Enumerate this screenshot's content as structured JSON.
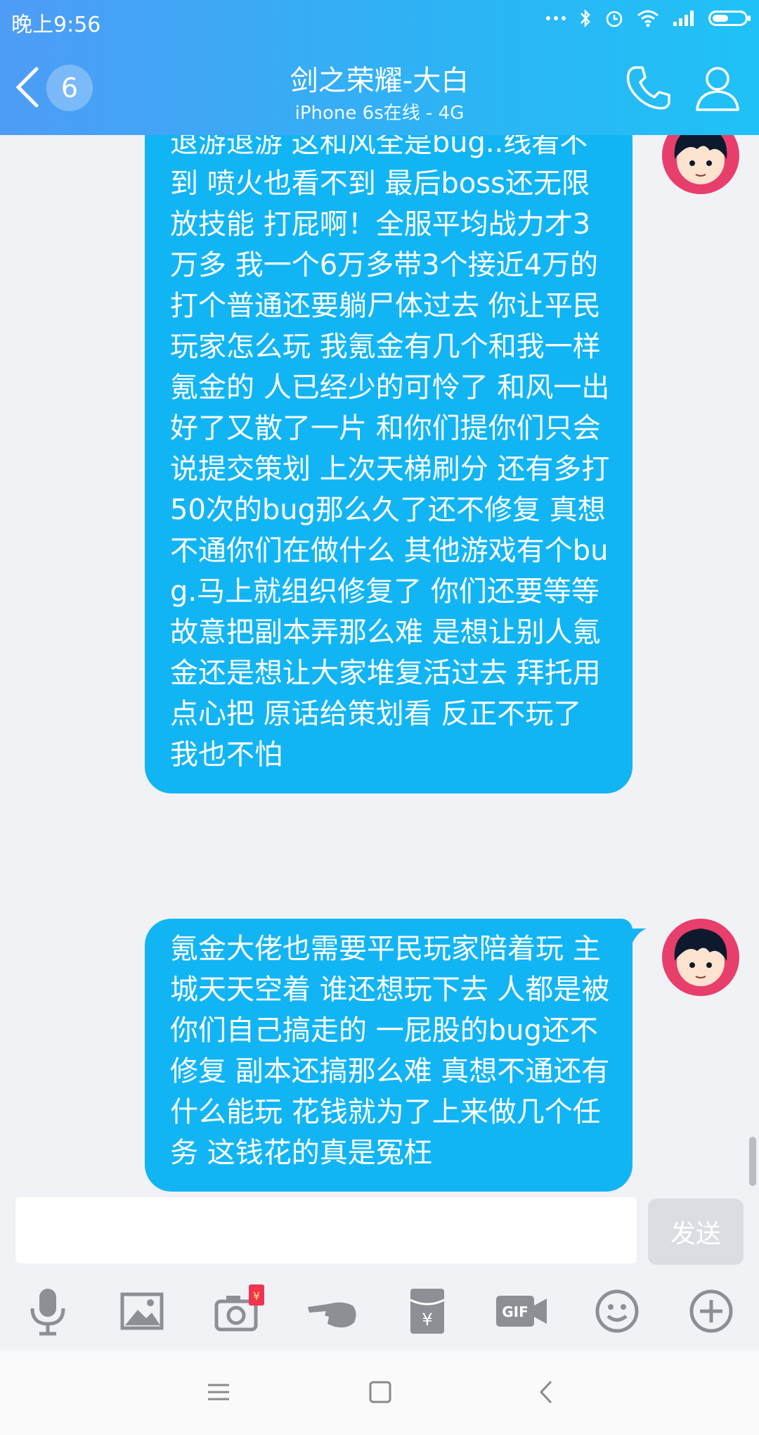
{
  "status_bar": {
    "time": "晚上9:56"
  },
  "header": {
    "unread_count": "6",
    "title": "剑之荣耀-大白",
    "subtitle": "iPhone 6s在线 - 4G"
  },
  "messages": [
    {
      "text": "退游退游  这和风全是bug..线看不到  喷火也看不到  最后boss还无限放技能  打屁啊！全服平均战力才3万多 我一个6万多带3个接近4万的打个普通还要躺尸体过去  你让平民玩家怎么玩  我氪金有几个和我一样氪金的  人已经少的可怜了  和风一出 好了又散了一片  和你们提你们只会说提交策划  上次天梯刷分 还有多打50次的bug那么久了还不修复  真想不通你们在做什么  其他游戏有个bug.马上就组织修复了  你们还要等等  故意把副本弄那么难  是想让别人氪金还是想让大家堆复活过去 拜托用点心把  原话给策划看  反正不玩了  我也不怕"
    },
    {
      "text": "氪金大佬也需要平民玩家陪着玩  主城天天空着  谁还想玩下去  人都是被你们自己搞走的  一屁股的bug还不修复  副本还搞那么难  真想不通还有什么能玩  花钱就为了上来做几个任务  这钱花的真是冤枉"
    }
  ],
  "input": {
    "value": "",
    "send_label": "发送"
  },
  "toolbar": {
    "items": [
      "microphone-icon",
      "image-icon",
      "camera-redpacket-icon",
      "poke-hand-icon",
      "red-envelope-icon",
      "gif-icon",
      "emoji-icon",
      "plus-icon"
    ],
    "red_badge_text": "¥"
  },
  "colors": {
    "header_start": "#4e9cf6",
    "header_end": "#1fc2f6",
    "bubble": "#12b5f4",
    "avatar_bg": "#e83e6c"
  }
}
